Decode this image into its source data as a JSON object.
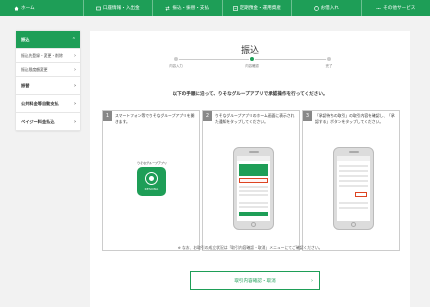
{
  "topnav": {
    "items": [
      {
        "label": "ホーム",
        "icon": "home-icon"
      },
      {
        "label": "口座情報・入出金",
        "icon": "account-icon"
      },
      {
        "label": "振込・振替・支払",
        "icon": "transfer-icon"
      },
      {
        "label": "定期預金・運用資産",
        "icon": "deposit-icon"
      },
      {
        "label": "お借入れ",
        "icon": "loan-icon"
      },
      {
        "label": "その他サービス",
        "icon": "menu-icon"
      }
    ]
  },
  "sidebar": {
    "items": [
      {
        "label": "振込"
      },
      {
        "label": "振込先登録・変更・削除"
      },
      {
        "label": "振込限度額変更"
      },
      {
        "label": "振替"
      },
      {
        "label": "公共料金等自動支払"
      },
      {
        "label": "ペイジー料金払込"
      }
    ]
  },
  "main": {
    "title": "振込",
    "steps": [
      "内容入力",
      "内容確認",
      "完了"
    ],
    "instruction": "以下の手順に沿って、りそなグループアプリで承認操作を行ってください。",
    "panels": [
      {
        "num": "1",
        "text": "スマートフォン等でりそなグループアプリを開きます。",
        "app_label": "りそなグループアプリ",
        "app_brand": "RESONA"
      },
      {
        "num": "2",
        "text": "りそなグループアプリのホーム画面に表示された通知をタップしてください。"
      },
      {
        "num": "3",
        "text": "「承認待ちの取引」の取引内容を確認し、「承認する」ボタンをタップしてください。"
      }
    ],
    "note": "※ なお、お取引の成立状況は「取引内容確認・取消」メニューにてご確認ください。",
    "confirm_button": "取引内容確認・取消"
  },
  "colors": {
    "accent": "#1e9e57",
    "highlight": "#dd4422"
  }
}
